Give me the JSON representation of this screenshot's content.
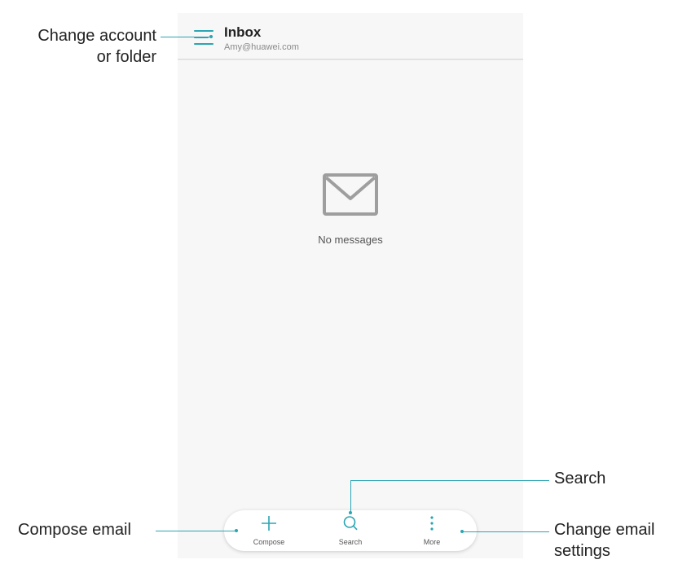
{
  "header": {
    "title": "Inbox",
    "account": "Amy@huawei.com",
    "menu_icon": "hamburger-menu-icon"
  },
  "empty_state": {
    "icon": "envelope-icon",
    "text": "No messages"
  },
  "toolbar": {
    "compose_label": "Compose",
    "search_label": "Search",
    "more_label": "More"
  },
  "callouts": {
    "account_folder_line1": "Change account",
    "account_folder_line2": "or folder",
    "search": "Search",
    "compose": "Compose email",
    "settings_line1": "Change email",
    "settings_line2": "settings"
  },
  "colors": {
    "accent": "#2aa5b2",
    "background": "#f7f7f7",
    "icon_gray": "#9e9e9e"
  }
}
